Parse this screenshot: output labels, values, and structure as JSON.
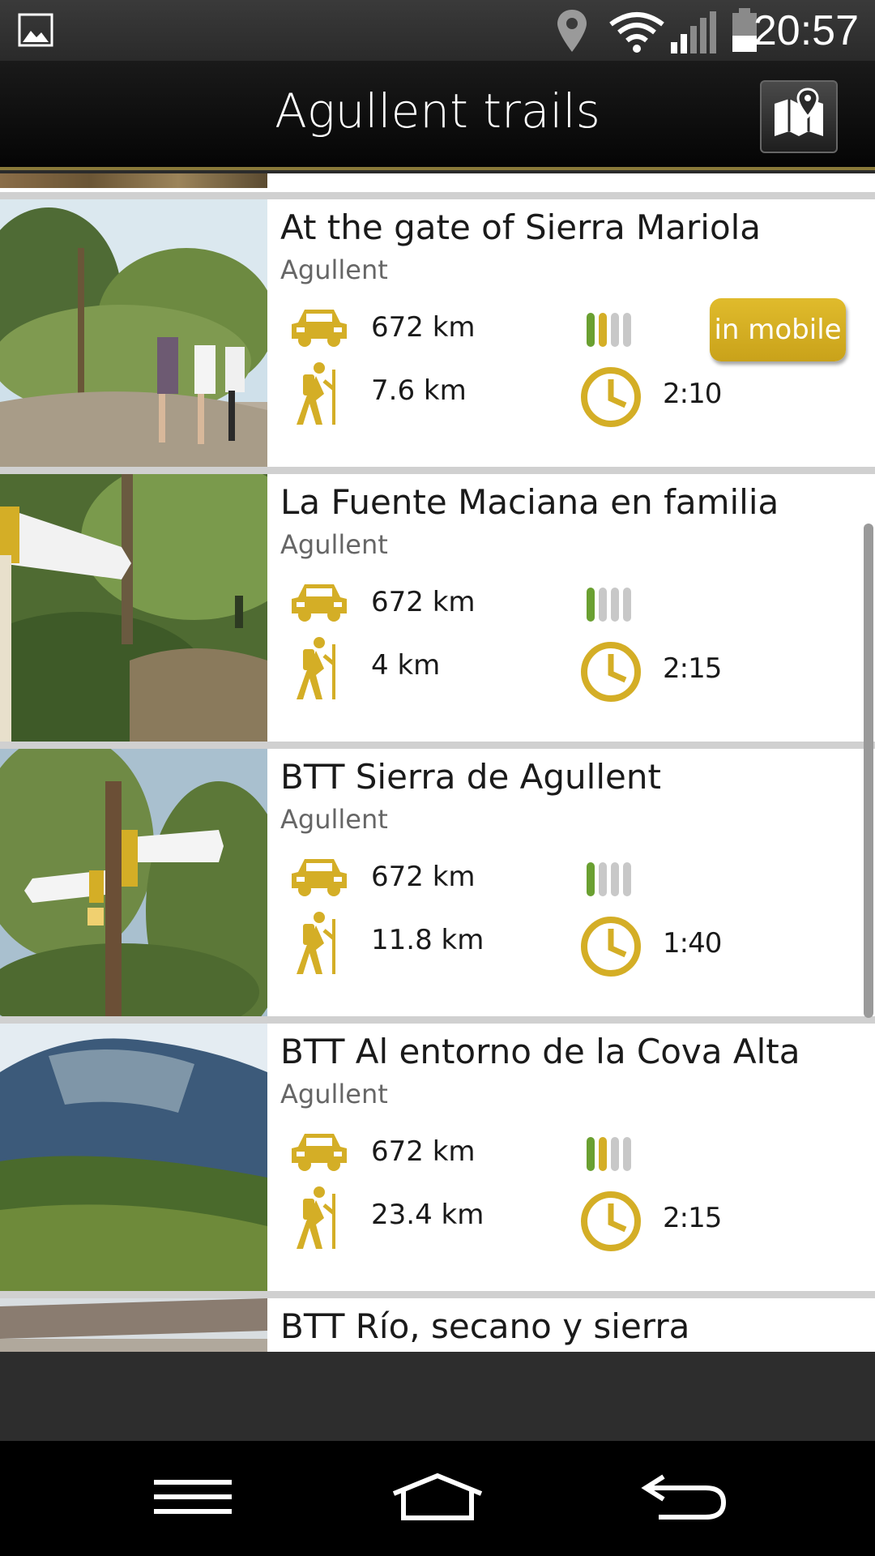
{
  "status_bar": {
    "time": "20:57"
  },
  "app_bar": {
    "title": "Agullent trails"
  },
  "trails": [
    {
      "name": "At the gate of Sierra Mariola",
      "region": "Agullent",
      "car_distance": "672 km",
      "walk_distance": "7.6 km",
      "duration": "2:10",
      "badge": "in mobile"
    },
    {
      "name": "La Fuente Maciana en familia",
      "region": "Agullent",
      "car_distance": "672 km",
      "walk_distance": "4 km",
      "duration": "2:15",
      "badge": ""
    },
    {
      "name": "BTT Sierra de Agullent",
      "region": "Agullent",
      "car_distance": "672 km",
      "walk_distance": "11.8 km",
      "duration": "1:40",
      "badge": ""
    },
    {
      "name": "BTT Al entorno de la Cova Alta",
      "region": "Agullent",
      "car_distance": "672 km",
      "walk_distance": "23.4 km",
      "duration": "2:15",
      "badge": ""
    },
    {
      "name": "BTT Río, secano y sierra",
      "region": "",
      "car_distance": "",
      "walk_distance": "",
      "duration": "",
      "badge": ""
    }
  ],
  "colors": {
    "accent": "#d4ae26",
    "difficulty_green": "#6aa031",
    "difficulty_yellow": "#d4ae26",
    "inactive": "#c8c8c8"
  },
  "icons": [
    "image-icon",
    "location-icon",
    "wifi-icon",
    "signal-icon",
    "battery-icon",
    "map-icon",
    "car-icon",
    "hiker-icon",
    "difficulty-icon",
    "clock-icon",
    "menu-icon",
    "home-icon",
    "back-icon"
  ]
}
